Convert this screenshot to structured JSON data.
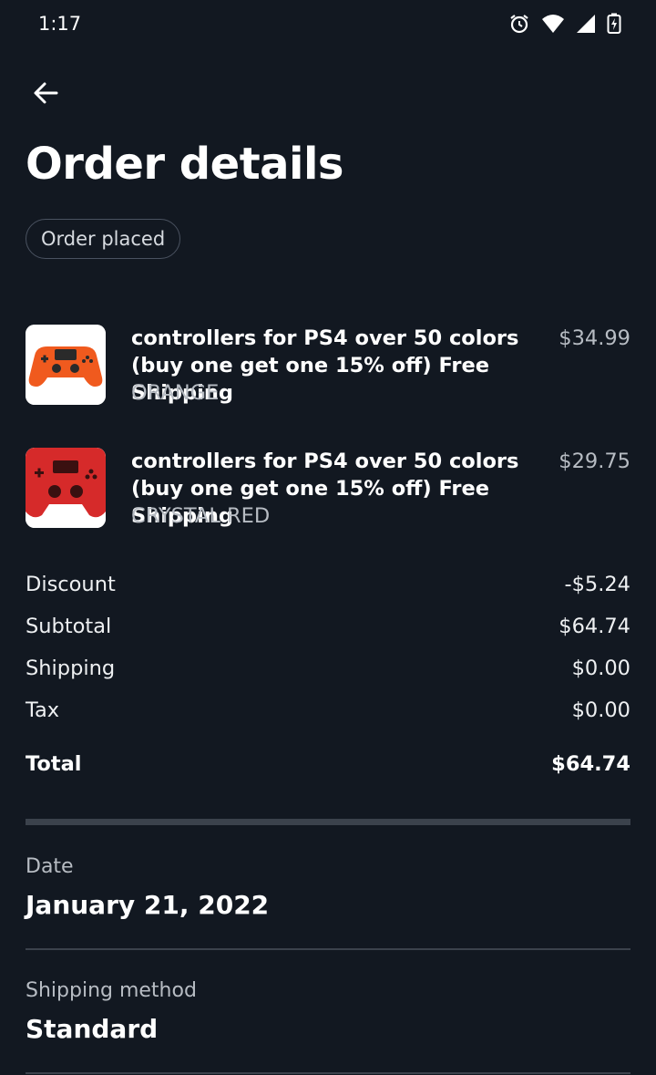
{
  "status_bar": {
    "time": "1:17",
    "icons": [
      "alarm-icon",
      "wifi-icon",
      "signal-icon",
      "battery-charging-icon"
    ]
  },
  "header": {
    "title": "Order details",
    "status_chip": "Order placed"
  },
  "items": [
    {
      "name": "controllers for PS4 over 50 colors (buy one get one 15% off) Free Shipping",
      "variant": "ORANGE",
      "price": "$34.99",
      "color": "#f05a1e"
    },
    {
      "name": "controllers for PS4 over 50 colors (buy one get one 15% off) Free Shipping",
      "variant": "CRYSTAL RED",
      "price": "$29.75",
      "color": "#d62a2a"
    }
  ],
  "summary": {
    "discount_label": "Discount",
    "discount_value": "-$5.24",
    "subtotal_label": "Subtotal",
    "subtotal_value": "$64.74",
    "shipping_label": "Shipping",
    "shipping_value": "$0.00",
    "tax_label": "Tax",
    "tax_value": "$0.00",
    "total_label": "Total",
    "total_value": "$64.74"
  },
  "details": {
    "date_label": "Date",
    "date_value": "January 21, 2022",
    "shipping_method_label": "Shipping method",
    "shipping_method_value": "Standard"
  },
  "colors": {
    "background": "#121821",
    "divider": "#3b424c",
    "muted_text": "#b7bcc3"
  }
}
